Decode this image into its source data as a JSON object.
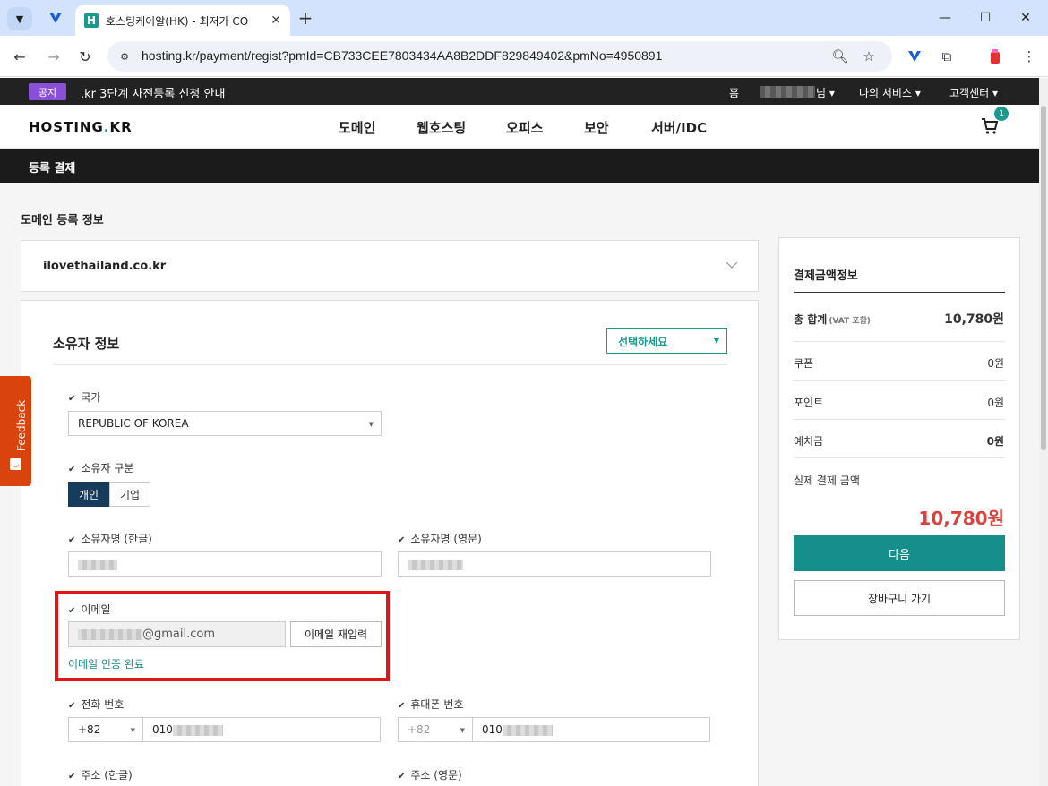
{
  "browser": {
    "tab_title": "호스팅케이알(HK) - 최저가 CO",
    "url": "hosting.kr/payment/regist?pmId=CB733CEE7803434AA8B2DDF829849402&pmNo=4950891"
  },
  "notice": {
    "badge": "공지",
    "text": ".kr 3단계 사전등록 신청 안내"
  },
  "util_nav": {
    "home": "홈",
    "user_suffix": "님 ▾",
    "my_services": "나의 서비스 ▾",
    "support": "고객센터 ▾"
  },
  "site": {
    "logo_left": "HOSTING",
    "logo_dot": ".",
    "logo_right": "KR",
    "menu": [
      "도메인",
      "웹호스팅",
      "오피스",
      "보안",
      "서버/IDC"
    ],
    "cart_count": "1"
  },
  "page_title": "등록 결제",
  "section_title": "도메인 등록 정보",
  "domain": "ilovethailand.co.kr",
  "owner": {
    "title": "소유자 정보",
    "select_label": "선택하세요",
    "country_label": "국가",
    "country_value": "REPUBLIC OF KOREA",
    "type_label": "소유자 구분",
    "type_personal": "개인",
    "type_company": "기업",
    "name_kr_label": "소유자명 (한글)",
    "name_en_label": "소유자명 (영문)",
    "email_label": "이메일",
    "email_domain": "@gmail.com",
    "email_reenter": "이메일 재입력",
    "email_verified": "이메일 인증 완료",
    "phone_label": "전화 번호",
    "phone_code": "+82",
    "phone_prefix": "010",
    "mobile_label": "휴대폰 번호",
    "mobile_code": "+82",
    "mobile_prefix": "010",
    "addr_kr_label": "주소 (한글)",
    "addr_en_label": "주소 (영문)"
  },
  "summary": {
    "title": "결제금액정보",
    "total_label": "총 합계",
    "vat_note": "(VAT 포함)",
    "total_value": "10,780원",
    "coupon_label": "쿠폰",
    "coupon_value": "0원",
    "point_label": "포인트",
    "point_value": "0원",
    "deposit_label": "예치금",
    "deposit_value": "0원",
    "actual_label": "실제 결제 금액",
    "actual_value": "10,780원",
    "next_button": "다음",
    "cart_button": "장바구니 가기"
  },
  "feedback": "Feedback"
}
